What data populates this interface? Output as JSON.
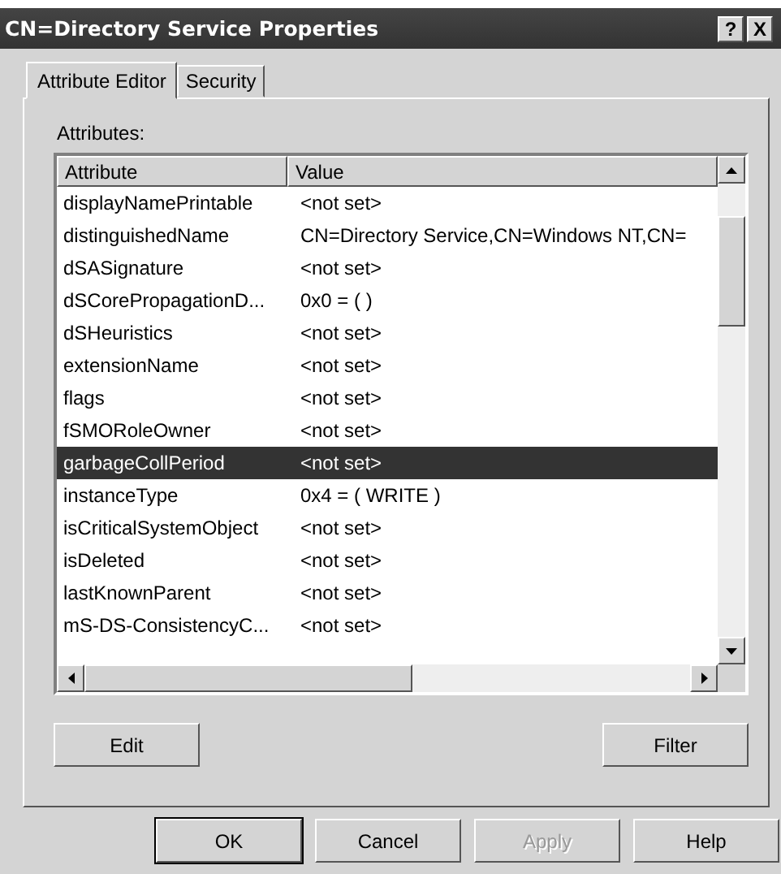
{
  "window": {
    "title": "CN=Directory Service Properties",
    "help_button": "?",
    "close_button": "X"
  },
  "tabs": [
    {
      "label": "Attribute Editor",
      "selected": true
    },
    {
      "label": "Security",
      "selected": false
    }
  ],
  "attributes_label": "Attributes:",
  "table": {
    "columns": [
      "Attribute",
      "Value"
    ],
    "rows": [
      {
        "attribute": "displayNamePrintable",
        "value": "<not set>",
        "selected": false
      },
      {
        "attribute": "distinguishedName",
        "value": "CN=Directory Service,CN=Windows NT,CN=",
        "selected": false
      },
      {
        "attribute": "dSASignature",
        "value": "<not set>",
        "selected": false
      },
      {
        "attribute": "dSCorePropagationD...",
        "value": "0x0 = (  )",
        "selected": false
      },
      {
        "attribute": "dSHeuristics",
        "value": "<not set>",
        "selected": false
      },
      {
        "attribute": "extensionName",
        "value": "<not set>",
        "selected": false
      },
      {
        "attribute": "flags",
        "value": "<not set>",
        "selected": false
      },
      {
        "attribute": "fSMORoleOwner",
        "value": "<not set>",
        "selected": false
      },
      {
        "attribute": "garbageCollPeriod",
        "value": "<not set>",
        "selected": true
      },
      {
        "attribute": "instanceType",
        "value": "0x4 = ( WRITE )",
        "selected": false
      },
      {
        "attribute": "isCriticalSystemObject",
        "value": "<not set>",
        "selected": false
      },
      {
        "attribute": "isDeleted",
        "value": "<not set>",
        "selected": false
      },
      {
        "attribute": "lastKnownParent",
        "value": "<not set>",
        "selected": false
      },
      {
        "attribute": "mS-DS-ConsistencyC...",
        "value": "<not set>",
        "selected": false
      }
    ]
  },
  "panel_buttons": [
    {
      "label": "Edit",
      "disabled": false
    },
    {
      "label": "Filter",
      "disabled": false
    }
  ],
  "buttons": [
    {
      "label": "OK",
      "default": true,
      "disabled": false
    },
    {
      "label": "Cancel",
      "default": false,
      "disabled": false
    },
    {
      "label": "Apply",
      "default": false,
      "disabled": true
    },
    {
      "label": "Help",
      "default": false,
      "disabled": false
    }
  ]
}
